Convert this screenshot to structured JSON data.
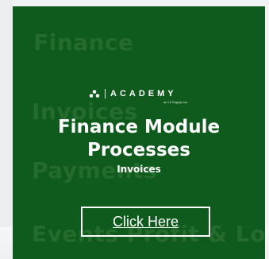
{
  "banner": {
    "background_words": [
      "Finance",
      "Invoices",
      "Payments",
      "Events Profit & Loss"
    ],
    "logo": {
      "icon": "academy-triangle-dots-icon",
      "text": "ACADEMY",
      "tagline": "an L5 Supply Inc."
    },
    "title_line1": "Finance Module",
    "title_line2": "Processes",
    "subtitle": "Invoices",
    "cta_label": "Click Here"
  },
  "colors": {
    "banner_background": "#0f5a1d",
    "faded_text": "#2a6f30",
    "foreground": "#ffffff",
    "page_background": "#f1f3f4"
  }
}
